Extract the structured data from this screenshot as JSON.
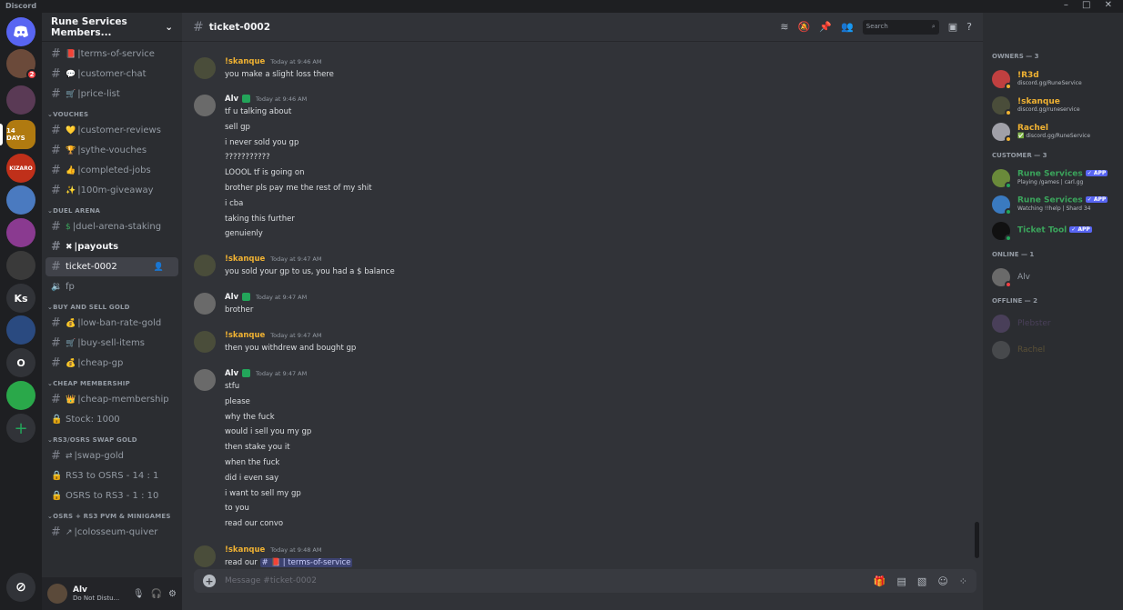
{
  "app": {
    "name": "Discord",
    "window_controls": "– □ ✕"
  },
  "guild": {
    "name": "Rune Services Members..."
  },
  "sidebar": {
    "channels_top": [
      {
        "emoji": "📕",
        "name": "terms-of-service"
      },
      {
        "emoji": "💬",
        "name": "customer-chat"
      },
      {
        "emoji": "🛒",
        "name": "price-list"
      }
    ],
    "categories": [
      {
        "name": "VOUCHES",
        "channels": [
          {
            "emoji": "💛",
            "name": "customer-reviews"
          },
          {
            "emoji": "🏆",
            "name": "sythe-vouches"
          },
          {
            "emoji": "👍",
            "name": "completed-jobs"
          },
          {
            "emoji": "✨",
            "name": "100m-giveaway"
          }
        ]
      },
      {
        "name": "DUEL ARENA",
        "channels": [
          {
            "emoji": "$",
            "name": "duel-arena-staking"
          },
          {
            "emoji": "✖",
            "name": "payouts"
          },
          {
            "emoji": "",
            "name": "ticket-0002"
          },
          {
            "emoji": "",
            "name": "fp"
          }
        ]
      },
      {
        "name": "BUY AND SELL GOLD",
        "channels": [
          {
            "emoji": "💰",
            "name": "low-ban-rate-gold"
          },
          {
            "emoji": "🛒",
            "name": "buy-sell-items"
          },
          {
            "emoji": "💰",
            "name": "cheap-gp"
          }
        ]
      },
      {
        "name": "CHEAP MEMBERSHIP",
        "channels": [
          {
            "emoji": "👑",
            "name": "cheap-membership"
          },
          {
            "emoji": "",
            "name": "Stock: 1000"
          }
        ]
      },
      {
        "name": "RS3/OSRS SWAP GOLD",
        "channels": [
          {
            "emoji": "⇄",
            "name": "swap-gold"
          },
          {
            "emoji": "",
            "name": "RS3 to OSRS - 14 : 1"
          },
          {
            "emoji": "",
            "name": "OSRS to RS3 - 1 : 10"
          }
        ]
      },
      {
        "name": "OSRS + RS3 PVM & MINIGAMES",
        "channels": [
          {
            "emoji": "↗",
            "name": "colosseum-quiver"
          }
        ]
      }
    ]
  },
  "user_panel": {
    "name": "Alv",
    "status": "Do Not Distu..."
  },
  "channel": {
    "name": "ticket-0002",
    "search_placeholder": "Search",
    "composer_placeholder": "Message #ticket-0002"
  },
  "messages": [
    {
      "author": "!skanque",
      "color": "#f0b232",
      "time": "Today at 9:46 AM",
      "lines": [
        "you make a slight loss there"
      ]
    },
    {
      "author": "Alv",
      "color": "#f2f3f5",
      "time": "Today at 9:46 AM",
      "lines": [
        "tf u talking about",
        "sell gp",
        "i never sold you gp",
        "???????????",
        "LOOOL tf is going on",
        "brother pls pay me the rest of my shit",
        "i cba",
        "taking this further",
        "genuienly"
      ]
    },
    {
      "author": "!skanque",
      "color": "#f0b232",
      "time": "Today at 9:47 AM",
      "lines": [
        "you sold your gp to us, you had a $ balance"
      ]
    },
    {
      "author": "Alv",
      "color": "#f2f3f5",
      "time": "Today at 9:47 AM",
      "lines": [
        "brother"
      ]
    },
    {
      "author": "!skanque",
      "color": "#f0b232",
      "time": "Today at 9:47 AM",
      "lines": [
        "then you withdrew and bought gp"
      ]
    },
    {
      "author": "Alv",
      "color": "#f2f3f5",
      "time": "Today at 9:47 AM",
      "lines": [
        "stfu",
        "please",
        "why the fuck",
        "would i sell you my gp",
        "then stake you it",
        "when the fuck",
        "did i even say",
        "i want to sell my gp",
        "to you",
        "read our convo"
      ]
    },
    {
      "author": "!skanque",
      "color": "#f0b232",
      "time": "Today at 9:48 AM",
      "lines": [
        "read our"
      ],
      "mention": "# 📕 | terms-of-service"
    }
  ],
  "members": {
    "owners_label": "OWNERS — 3",
    "owners": [
      {
        "name": "!R3d",
        "sub": "discord.gg/RuneService",
        "color": "#f0b232"
      },
      {
        "name": "!skanque",
        "sub": "discord.gg/runeservice",
        "color": "#f0b232"
      },
      {
        "name": "Rachel",
        "sub": "✅ discord.gg/RuneService",
        "color": "#f0b232"
      }
    ],
    "customer_label": "CUSTOMER — 3",
    "customers": [
      {
        "name": "Rune Services",
        "sub": "Playing /games | carl.gg",
        "color": "#3ba55c",
        "tag": "✓ APP"
      },
      {
        "name": "Rune Services",
        "sub": "Watching !!help | Shard 34",
        "color": "#3ba55c",
        "tag": "✓ APP"
      },
      {
        "name": "Ticket Tool",
        "sub": "",
        "color": "#3ba55c",
        "tag": "✓ APP"
      }
    ],
    "online_label": "ONLINE — 1",
    "online": [
      {
        "name": "Alv",
        "color": "#949ba4"
      }
    ],
    "offline_label": "OFFLINE — 2",
    "offline": [
      {
        "name": "Plebster",
        "color": "#8e6bb5"
      },
      {
        "name": "Rachel",
        "color": "#c8a040"
      }
    ]
  },
  "servers": [
    {
      "label": "",
      "color": "#5865f2",
      "icon": "discord-logo"
    },
    {
      "label": "",
      "color": "#6b4a3a",
      "badge": "2"
    },
    {
      "label": "",
      "color": "#5a3a55"
    },
    {
      "label": "14 DAYS",
      "color": "#b07a10"
    },
    {
      "label": "KIZARO",
      "color": "#c0301a"
    },
    {
      "label": "",
      "color": "#4a7ac0"
    },
    {
      "label": "",
      "color": "#8a3a90"
    },
    {
      "label": "",
      "color": "#3a3a3a"
    },
    {
      "label": "Ks",
      "color": "#313338"
    },
    {
      "label": "",
      "color": "#2a4a80"
    },
    {
      "label": "O",
      "color": "#313338"
    },
    {
      "label": "",
      "color": "#2aa84a"
    }
  ]
}
